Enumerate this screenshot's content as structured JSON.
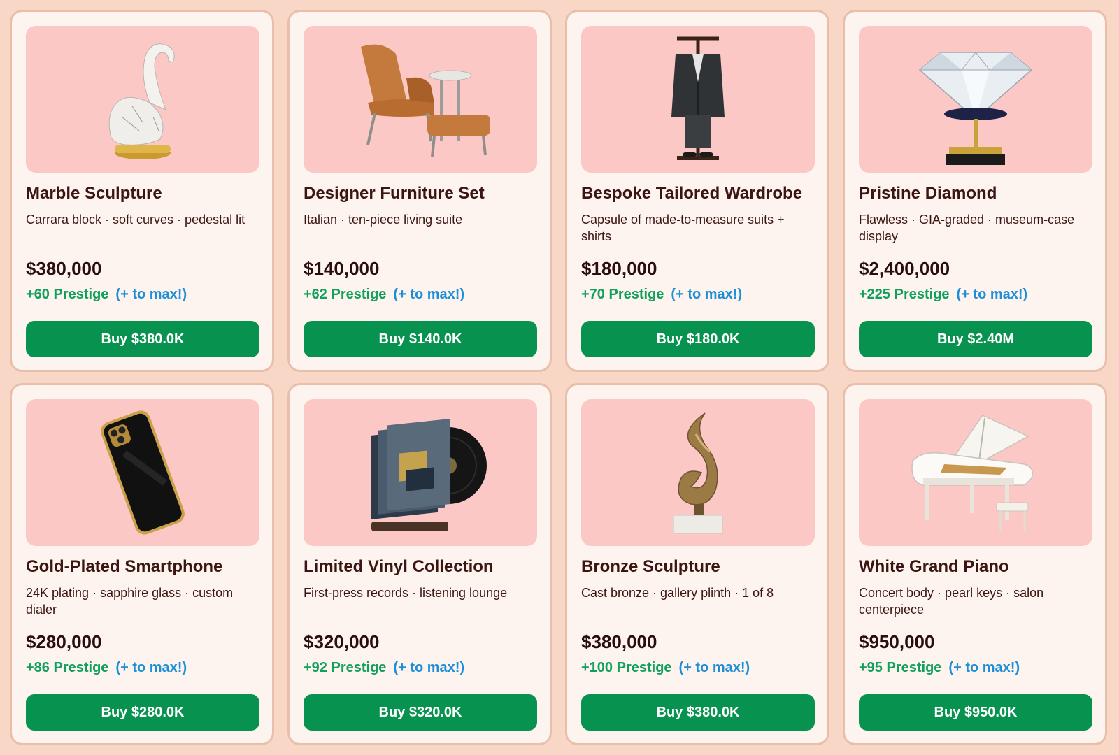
{
  "colors": {
    "page_background": "#f8d7c6",
    "card_background": "#fdf4ef",
    "card_border": "#e8bfaa",
    "image_background": "#fcc8c6",
    "title_text": "#3b1512",
    "prestige_green": "#10a05b",
    "to_max_blue": "#1e8fd6",
    "buy_button": "#07934f"
  },
  "items": [
    {
      "title": "Marble Sculpture",
      "description": "Carrara block · soft curves · pedestal lit",
      "price": "$380,000",
      "prestige": "+60 Prestige",
      "to_max": "(+ to max!)",
      "buy_label": "Buy $380.0K",
      "icon": "marble-swan-sculpture-icon"
    },
    {
      "title": "Designer Furniture Set",
      "description": "Italian · ten-piece living suite",
      "price": "$140,000",
      "prestige": "+62 Prestige",
      "to_max": "(+ to max!)",
      "buy_label": "Buy $140.0K",
      "icon": "lounge-chair-ottoman-icon"
    },
    {
      "title": "Bespoke Tailored Wardrobe",
      "description": "Capsule of made-to-measure suits + shirts",
      "price": "$180,000",
      "prestige": "+70 Prestige",
      "to_max": "(+ to max!)",
      "buy_label": "Buy $180.0K",
      "icon": "suit-valet-stand-icon"
    },
    {
      "title": "Pristine Diamond",
      "description": "Flawless · GIA-graded · museum-case display",
      "price": "$2,400,000",
      "prestige": "+225 Prestige",
      "to_max": "(+ to max!)",
      "buy_label": "Buy $2.40M",
      "icon": "diamond-on-pedestal-icon"
    },
    {
      "title": "Gold-Plated Smartphone",
      "description": "24K plating · sapphire glass · custom dialer",
      "price": "$280,000",
      "prestige": "+86 Prestige",
      "to_max": "(+ to max!)",
      "buy_label": "Buy $280.0K",
      "icon": "gold-smartphone-icon"
    },
    {
      "title": "Limited Vinyl Collection",
      "description": "First-press records · listening lounge",
      "price": "$320,000",
      "prestige": "+92 Prestige",
      "to_max": "(+ to max!)",
      "buy_label": "Buy $320.0K",
      "icon": "vinyl-records-icon"
    },
    {
      "title": "Bronze Sculpture",
      "description": "Cast bronze · gallery plinth · 1 of 8",
      "price": "$380,000",
      "prestige": "+100 Prestige",
      "to_max": "(+ to max!)",
      "buy_label": "Buy $380.0K",
      "icon": "bronze-abstract-sculpture-icon"
    },
    {
      "title": "White Grand Piano",
      "description": "Concert body · pearl keys · salon centerpiece",
      "price": "$950,000",
      "prestige": "+95 Prestige",
      "to_max": "(+ to max!)",
      "buy_label": "Buy $950.0K",
      "icon": "white-grand-piano-icon"
    }
  ]
}
